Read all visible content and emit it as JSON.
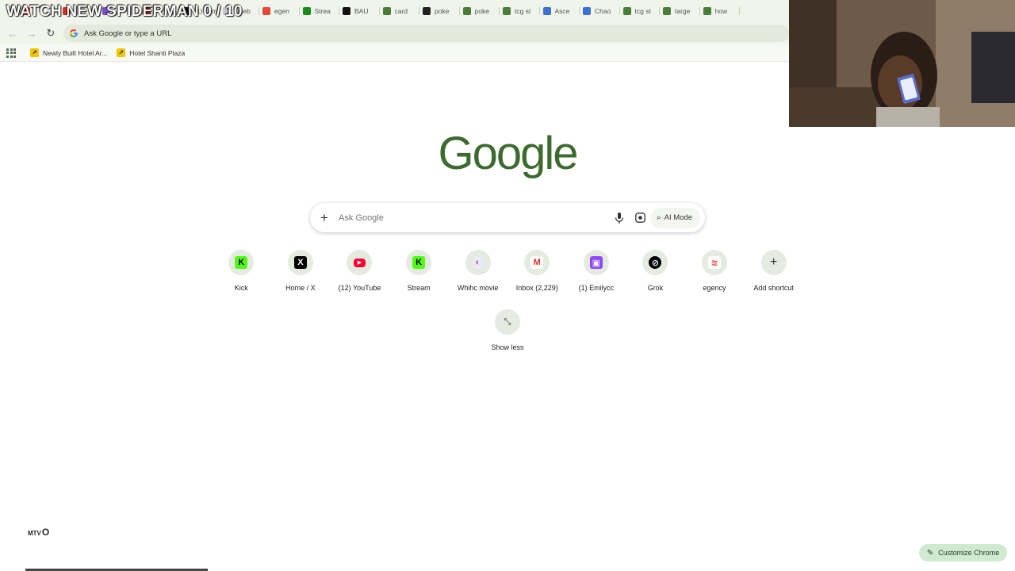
{
  "overlay_text": "WATCH NEW SPIDERMAN 0 / 10",
  "tabs": [
    {
      "label": "",
      "icon": "red-icon",
      "color": "#d93025"
    },
    {
      "label": "",
      "icon": "red-icon",
      "color": "#d93025"
    },
    {
      "label": "",
      "icon": "purple-icon",
      "color": "#7b4ccf"
    },
    {
      "label": "",
      "icon": "red-icon",
      "color": "#c5221f"
    },
    {
      "label": "(1) com",
      "icon": "x-icon",
      "color": "#111111"
    },
    {
      "label": "cineb",
      "icon": "globe-icon",
      "color": "#c8c8c8"
    },
    {
      "label": "egen",
      "icon": "egency-icon",
      "color": "#e0483a"
    },
    {
      "label": "Strea",
      "icon": "kick-icon",
      "color": "#1a8a1a"
    },
    {
      "label": "BAU",
      "icon": "x-icon",
      "color": "#111111"
    },
    {
      "label": "card",
      "icon": "google-icon",
      "color": "#4a7d3a"
    },
    {
      "label": "poke",
      "icon": "grok-icon",
      "color": "#222222"
    },
    {
      "label": "poke",
      "icon": "google-icon",
      "color": "#4a7d3a"
    },
    {
      "label": "tcg st",
      "icon": "google-icon",
      "color": "#4a7d3a"
    },
    {
      "label": "Asce",
      "icon": "copilot-icon",
      "color": "#3b6fd6"
    },
    {
      "label": "Chao",
      "icon": "copilot-icon",
      "color": "#3b6fd6"
    },
    {
      "label": "tcg st",
      "icon": "google-icon",
      "color": "#4a7d3a"
    },
    {
      "label": "targe",
      "icon": "google-icon",
      "color": "#4a7d3a"
    },
    {
      "label": "how",
      "icon": "google-icon",
      "color": "#4a7d3a"
    }
  ],
  "omnibox": {
    "text": "Ask Google or type a URL"
  },
  "bookmarks": [
    {
      "label": "Newly Built Hotel Ar..."
    },
    {
      "label": "Hotel Shanti Plaza"
    }
  ],
  "logo": "Google",
  "search": {
    "placeholder": "Ask Google",
    "ai_mode_label": "AI Mode"
  },
  "shortcuts": [
    {
      "label": "Kick",
      "icon": "kick-icon",
      "color": "#53fc18",
      "glyph": "K",
      "text_color": "#000000"
    },
    {
      "label": "Home / X",
      "icon": "x-icon",
      "color": "#000000",
      "glyph": "X",
      "text_color": "#ffffff"
    },
    {
      "label": "(12) YouTube",
      "icon": "youtube-icon",
      "color": "#ff0033",
      "glyph": "▶",
      "text_color": "#ffffff"
    },
    {
      "label": "Stream",
      "icon": "kick-icon",
      "color": "#53fc18",
      "glyph": "K",
      "text_color": "#000000"
    },
    {
      "label": "Whihc movie",
      "icon": "perplexity-icon",
      "color": "#e8eaf7",
      "glyph": "◐",
      "text_color": "#c85a8a"
    },
    {
      "label": "Inbox (2,229)",
      "icon": "gmail-icon",
      "color": "#ffffff",
      "glyph": "M",
      "text_color": "#d93025"
    },
    {
      "label": "(1) Emilycc",
      "icon": "twitch-icon",
      "color": "#9146ff",
      "glyph": "▣",
      "text_color": "#ffffff"
    },
    {
      "label": "Grok",
      "icon": "grok-icon",
      "color": "#000000",
      "glyph": "⊘",
      "text_color": "#ffffff"
    },
    {
      "label": "egency",
      "icon": "egency-icon",
      "color": "#ffffff",
      "glyph": "≋",
      "text_color": "#e0483a"
    },
    {
      "label": "Add shortcut",
      "icon": "plus-icon",
      "color": "transparent",
      "glyph": "+",
      "text_color": "#333333"
    }
  ],
  "show_less": {
    "label": "Show less"
  },
  "watermark": "MTV",
  "customize": {
    "label": "Customize Chrome"
  }
}
